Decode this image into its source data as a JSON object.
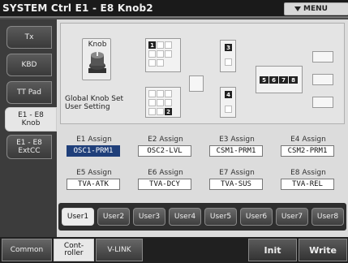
{
  "title": "SYSTEM Ctrl E1 - E8 Knob2",
  "menu_label": "MENU",
  "left_tabs": [
    "Tx",
    "KBD",
    "TT Pad",
    "E1 - E8\nKnob",
    "E1 - E8\nExtCC"
  ],
  "knob": {
    "label": "Knob",
    "icon": "knob-icon"
  },
  "global_label": "Global Knob Set\nUser Setting",
  "layout_numbers": {
    "first": "1",
    "second": "2",
    "third": "3",
    "fourth": "4",
    "group": [
      "5",
      "6",
      "7",
      "8"
    ]
  },
  "assign_rows": [
    [
      {
        "label": "E1 Assign",
        "value": "OSC1-PRM1",
        "selected": true
      },
      {
        "label": "E2 Assign",
        "value": "OSC2-LVL"
      },
      {
        "label": "E3 Assign",
        "value": "CSM1-PRM1"
      },
      {
        "label": "E4 Assign",
        "value": "CSM2-PRM1"
      }
    ],
    [
      {
        "label": "E5 Assign",
        "value": "TVA-ATK"
      },
      {
        "label": "E6 Assign",
        "value": "TVA-DCY"
      },
      {
        "label": "E7 Assign",
        "value": "TVA-SUS"
      },
      {
        "label": "E8 Assign",
        "value": "TVA-REL"
      }
    ]
  ],
  "user_buttons": [
    "User1",
    "User2",
    "User3",
    "User4",
    "User5",
    "User6",
    "User7",
    "User8"
  ],
  "bottom": {
    "common": "Common",
    "controller": "Cont-\nroller",
    "vlink": "V-LINK",
    "init": "Init",
    "write": "Write"
  },
  "colors": {
    "selection": "#1f3f7a",
    "panel": "#dcdcdc"
  }
}
